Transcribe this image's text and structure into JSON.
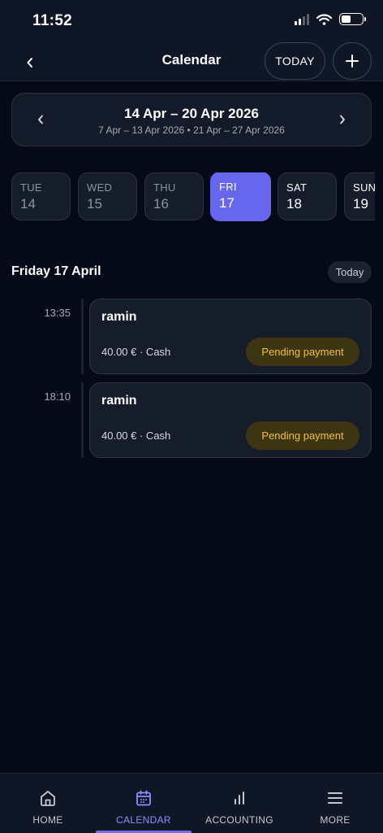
{
  "status_bar": {
    "time": "11:52"
  },
  "header": {
    "title": "Calendar",
    "today_label": "TODAY"
  },
  "week": {
    "title": "14 Apr – 20 Apr 2026",
    "subtitle": "7 Apr – 13 Apr 2026 • 21 Apr – 27 Apr 2026"
  },
  "days": [
    {
      "dow": "TUE",
      "num": "14"
    },
    {
      "dow": "WED",
      "num": "15"
    },
    {
      "dow": "THU",
      "num": "16"
    },
    {
      "dow": "FRI",
      "num": "17"
    },
    {
      "dow": "SAT",
      "num": "18"
    },
    {
      "dow": "SUN",
      "num": "19"
    }
  ],
  "selected_day": {
    "heading": "Friday 17 April",
    "badge": "Today"
  },
  "appointments": [
    {
      "time": "13:35",
      "name": "ramin",
      "meta": "40.00 € · Cash",
      "status": "Pending payment"
    },
    {
      "time": "18:10",
      "name": "ramin",
      "meta": "40.00 € · Cash",
      "status": "Pending payment"
    }
  ],
  "tabs": [
    {
      "label": "HOME"
    },
    {
      "label": "CALENDAR"
    },
    {
      "label": "ACCOUNTING"
    },
    {
      "label": "MORE"
    }
  ],
  "colors": {
    "accent": "#6666ee",
    "background": "#040a18",
    "pending_text": "#f0c234",
    "pending_bg": "#3d3412"
  }
}
